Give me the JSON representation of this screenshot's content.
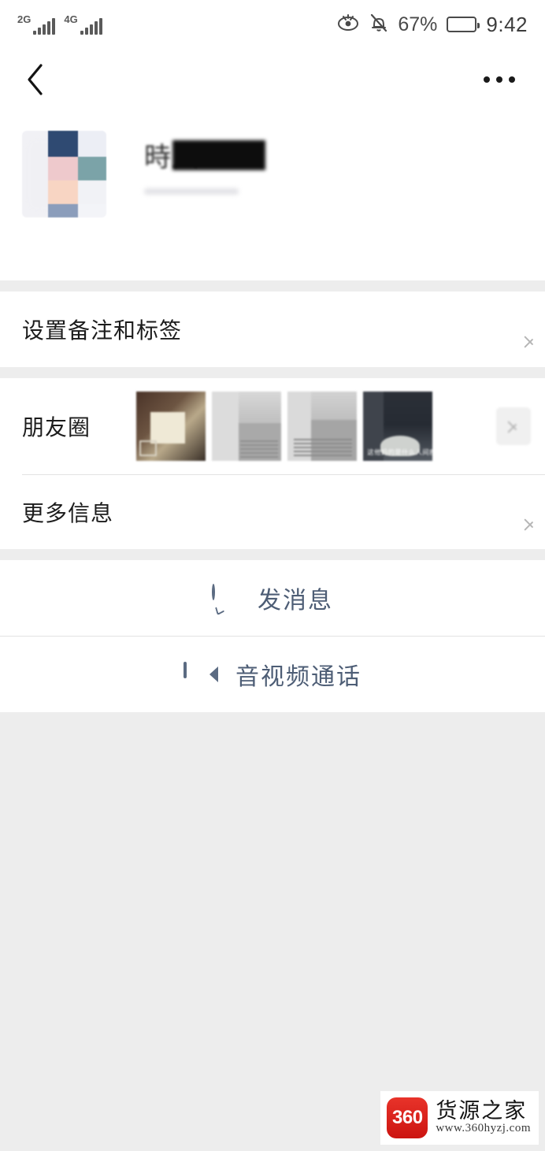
{
  "status_bar": {
    "signals": [
      {
        "label": "2G",
        "icon": "signal-bars-icon"
      },
      {
        "label": "4G",
        "icon": "signal-bars-icon"
      }
    ],
    "eye_comfort_icon": "eye-icon",
    "mute_icon": "bell-muted-icon",
    "battery_percent": "67%",
    "battery_icon": "battery-icon",
    "time": "9:42"
  },
  "nav": {
    "back_icon": "back-chevron-icon",
    "more_icon": "more-dots-icon"
  },
  "profile": {
    "avatar_name": "avatar",
    "display_name": "時入",
    "name_redacted": true,
    "avatar_colors": [
      "#2f4a72",
      "#eec9cc",
      "#f8d5c3",
      "#8b9dbb",
      "#7ba3a8",
      "#eef0f5"
    ]
  },
  "sections": {
    "remark_row": {
      "label": "设置备注和标签",
      "chevron": "chevron-right-icon"
    },
    "moments_row": {
      "label": "朋友圈",
      "chevron": "chevron-right-icon",
      "thumbnails": [
        {
          "name": "moment-thumbnail-1",
          "caption": ""
        },
        {
          "name": "moment-thumbnail-2",
          "caption": ""
        },
        {
          "name": "moment-thumbnail-3",
          "caption": ""
        },
        {
          "name": "moment-thumbnail-4",
          "caption": "这他妈的是什么人间疾苦"
        }
      ]
    },
    "more_info_row": {
      "label": "更多信息",
      "chevron": "chevron-right-icon"
    }
  },
  "actions": {
    "send_message": {
      "label": "发消息",
      "icon": "chat-bubble-icon"
    },
    "av_call": {
      "label": "音视频通话",
      "icon": "video-camera-icon"
    }
  },
  "watermark": {
    "logo_text": "360",
    "brand": "货源之家",
    "url": "www.360hyzj.com",
    "logo_color": "#e1251b"
  }
}
